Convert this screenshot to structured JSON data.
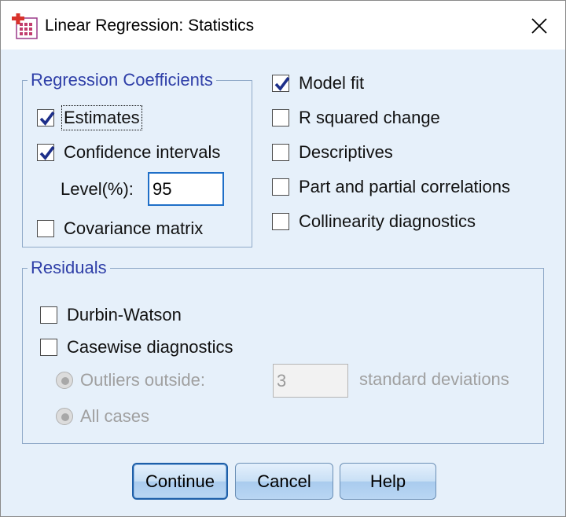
{
  "window": {
    "title": "Linear Regression: Statistics"
  },
  "regression_coefficients": {
    "legend": "Regression Coefficients",
    "estimates": {
      "label": "Estimates",
      "checked": true
    },
    "confidence_intervals": {
      "label": "Confidence intervals",
      "checked": true
    },
    "level_label": "Level(%):",
    "level_value": "95",
    "covariance_matrix": {
      "label": "Covariance matrix",
      "checked": false
    }
  },
  "right_options": {
    "model_fit": {
      "label": "Model fit",
      "checked": true
    },
    "r_squared_change": {
      "label": "R squared change",
      "checked": false
    },
    "descriptives": {
      "label": "Descriptives",
      "checked": false
    },
    "part_partial": {
      "label": "Part and partial correlations",
      "checked": false
    },
    "collinearity": {
      "label": "Collinearity diagnostics",
      "checked": false
    }
  },
  "residuals": {
    "legend": "Residuals",
    "durbin_watson": {
      "label": "Durbin-Watson",
      "checked": false
    },
    "casewise": {
      "label": "Casewise diagnostics",
      "checked": false
    },
    "outliers_label": "Outliers outside:",
    "outliers_value": "3",
    "std_dev_label": "standard deviations",
    "all_cases_label": "All cases"
  },
  "buttons": {
    "continue": "Continue",
    "cancel": "Cancel",
    "help": "Help"
  },
  "colors": {
    "accent": "#2f3fa8",
    "check": "#1d2f8a",
    "window_bg": "#e6f0fa",
    "disabled": "#a0a0a0"
  }
}
